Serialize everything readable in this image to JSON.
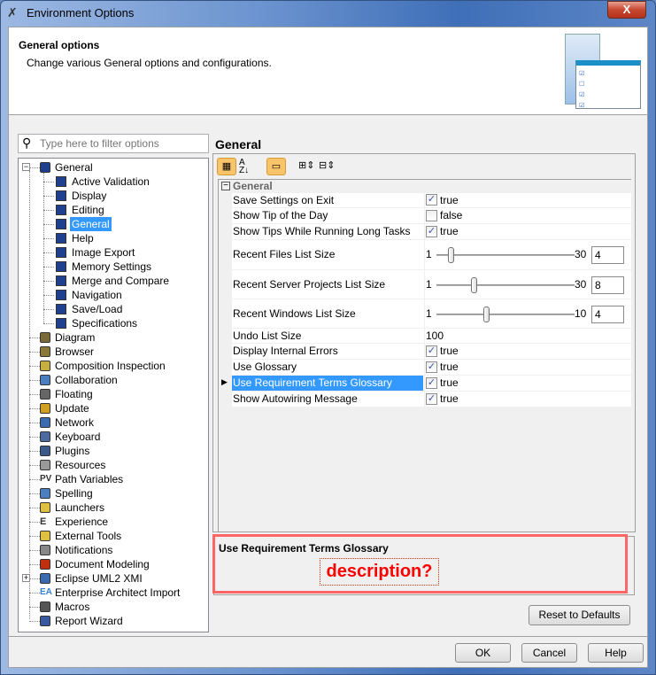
{
  "window": {
    "title": "Environment Options",
    "close": "X"
  },
  "header": {
    "title": "General options",
    "subtitle": "Change various General options and configurations."
  },
  "filter": {
    "placeholder": "Type here to filter options"
  },
  "tree": {
    "items": [
      {
        "label": "General",
        "level": 0,
        "expand": "−",
        "icon": "general-icon",
        "color": "#1f3f8f"
      },
      {
        "label": "Active Validation",
        "level": 1,
        "icon": "option-icon",
        "color": "#1f3f8f"
      },
      {
        "label": "Display",
        "level": 1,
        "icon": "option-icon",
        "color": "#1f3f8f"
      },
      {
        "label": "Editing",
        "level": 1,
        "icon": "option-icon",
        "color": "#1f3f8f"
      },
      {
        "label": "General",
        "level": 1,
        "icon": "option-icon",
        "color": "#1f3f8f",
        "selected": true
      },
      {
        "label": "Help",
        "level": 1,
        "icon": "option-icon",
        "color": "#1f3f8f"
      },
      {
        "label": "Image Export",
        "level": 1,
        "icon": "option-icon",
        "color": "#1f3f8f"
      },
      {
        "label": "Memory Settings",
        "level": 1,
        "icon": "option-icon",
        "color": "#1f3f8f"
      },
      {
        "label": "Merge and Compare",
        "level": 1,
        "icon": "option-icon",
        "color": "#1f3f8f"
      },
      {
        "label": "Navigation",
        "level": 1,
        "icon": "option-icon",
        "color": "#1f3f8f"
      },
      {
        "label": "Save/Load",
        "level": 1,
        "icon": "option-icon",
        "color": "#1f3f8f"
      },
      {
        "label": "Specifications",
        "level": 1,
        "icon": "option-icon",
        "color": "#1f3f8f"
      },
      {
        "label": "Diagram",
        "level": 0,
        "icon": "diagram-icon",
        "color": "#7a6a3a"
      },
      {
        "label": "Browser",
        "level": 0,
        "icon": "browser-icon",
        "color": "#8a7a3a"
      },
      {
        "label": "Composition Inspection",
        "level": 0,
        "icon": "composition-icon",
        "color": "#c8b040"
      },
      {
        "label": "Collaboration",
        "level": 0,
        "icon": "collaboration-icon",
        "color": "#4a80c0"
      },
      {
        "label": "Floating",
        "level": 0,
        "icon": "floating-icon",
        "color": "#666666"
      },
      {
        "label": "Update",
        "level": 0,
        "icon": "update-icon",
        "color": "#d0a020"
      },
      {
        "label": "Network",
        "level": 0,
        "icon": "network-icon",
        "color": "#3a6ab0"
      },
      {
        "label": "Keyboard",
        "level": 0,
        "icon": "keyboard-icon",
        "color": "#4a6aa0"
      },
      {
        "label": "Plugins",
        "level": 0,
        "icon": "plugins-icon",
        "color": "#3a5a8a"
      },
      {
        "label": "Resources",
        "level": 0,
        "icon": "resources-icon",
        "color": "#999999"
      },
      {
        "label": "Path Variables",
        "level": 0,
        "icon": "path-variables-icon",
        "glyph": "PV",
        "color": "#333333"
      },
      {
        "label": "Spelling",
        "level": 0,
        "icon": "spelling-icon",
        "color": "#4a80c0"
      },
      {
        "label": "Launchers",
        "level": 0,
        "icon": "launchers-icon",
        "color": "#e0c040"
      },
      {
        "label": "Experience",
        "level": 0,
        "icon": "experience-icon",
        "glyph": "E",
        "color": "#333333"
      },
      {
        "label": "External Tools",
        "level": 0,
        "icon": "external-tools-icon",
        "color": "#e0c040"
      },
      {
        "label": "Notifications",
        "level": 0,
        "icon": "notifications-icon",
        "color": "#888888"
      },
      {
        "label": "Document Modeling",
        "level": 0,
        "icon": "document-modeling-icon",
        "color": "#c03010"
      },
      {
        "label": "Eclipse UML2 XMI",
        "level": 0,
        "expand": "+",
        "icon": "eclipse-icon",
        "color": "#3a6ab0"
      },
      {
        "label": "Enterprise Architect Import",
        "level": 0,
        "icon": "ea-import-icon",
        "glyph": "EA",
        "color": "#3a80d0"
      },
      {
        "label": "Macros",
        "level": 0,
        "icon": "macros-icon",
        "color": "#555555"
      },
      {
        "label": "Report Wizard",
        "level": 0,
        "icon": "report-wizard-icon",
        "color": "#3a5aa0"
      }
    ]
  },
  "panel": {
    "title": "General",
    "group": "General"
  },
  "properties": [
    {
      "name": "Save Settings on Exit",
      "type": "bool",
      "checked": true,
      "value": "true"
    },
    {
      "name": "Show Tip of the Day",
      "type": "bool",
      "checked": false,
      "value": "false"
    },
    {
      "name": "Show Tips While Running Long Tasks",
      "type": "bool",
      "checked": true,
      "value": "true"
    },
    {
      "name": "Recent Files List Size",
      "type": "slider",
      "min": "1",
      "max": "30",
      "value": "4"
    },
    {
      "name": "Recent Server Projects List Size",
      "type": "slider",
      "min": "1",
      "max": "30",
      "value": "8"
    },
    {
      "name": "Recent Windows List Size",
      "type": "slider",
      "min": "1",
      "max": "10",
      "value": "4"
    },
    {
      "name": "Undo List Size",
      "type": "text",
      "value": "100"
    },
    {
      "name": "Display Internal Errors",
      "type": "bool",
      "checked": true,
      "value": "true"
    },
    {
      "name": "Use Glossary",
      "type": "bool",
      "checked": true,
      "value": "true"
    },
    {
      "name": "Use Requirement Terms Glossary",
      "type": "bool",
      "checked": true,
      "value": "true",
      "selected": true
    },
    {
      "name": "Show Autowiring Message",
      "type": "bool",
      "checked": true,
      "value": "true"
    }
  ],
  "description": {
    "title": "Use Requirement Terms Glossary",
    "annotation": "description?"
  },
  "buttons": {
    "reset": "Reset to Defaults",
    "ok": "OK",
    "cancel": "Cancel",
    "help": "Help"
  },
  "colors": {
    "selection": "#3399ff",
    "annotation": "#ff0000",
    "highlight_border": "#ff6666"
  }
}
